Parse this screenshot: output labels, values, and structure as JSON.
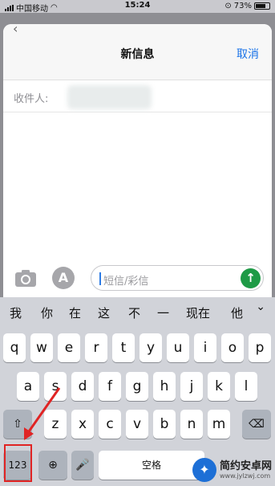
{
  "status_bar": {
    "carrier": "中国移动",
    "time": "15:24",
    "battery": "73%",
    "battery_level": 0.73
  },
  "nav": {
    "title": "新信息",
    "cancel": "取消"
  },
  "recipient": {
    "label": "收件人:"
  },
  "compose": {
    "placeholder": "短信/彩信"
  },
  "suggestions": [
    "我",
    "你",
    "在",
    "这",
    "不",
    "一",
    "现在",
    "他"
  ],
  "keyboard": {
    "row1": [
      "q",
      "w",
      "e",
      "r",
      "t",
      "y",
      "u",
      "i",
      "o",
      "p"
    ],
    "row2": [
      "a",
      "s",
      "d",
      "f",
      "g",
      "h",
      "j",
      "k",
      "l"
    ],
    "row3": [
      "z",
      "x",
      "c",
      "v",
      "b",
      "n",
      "m"
    ],
    "numbers_key": "123",
    "space_key": "空格"
  },
  "watermark": {
    "name": "简约安卓网",
    "url": "www.jylzwj.com"
  },
  "colors": {
    "accent": "#1a73e8",
    "send": "#1e9a46",
    "annotation": "#e02424"
  }
}
